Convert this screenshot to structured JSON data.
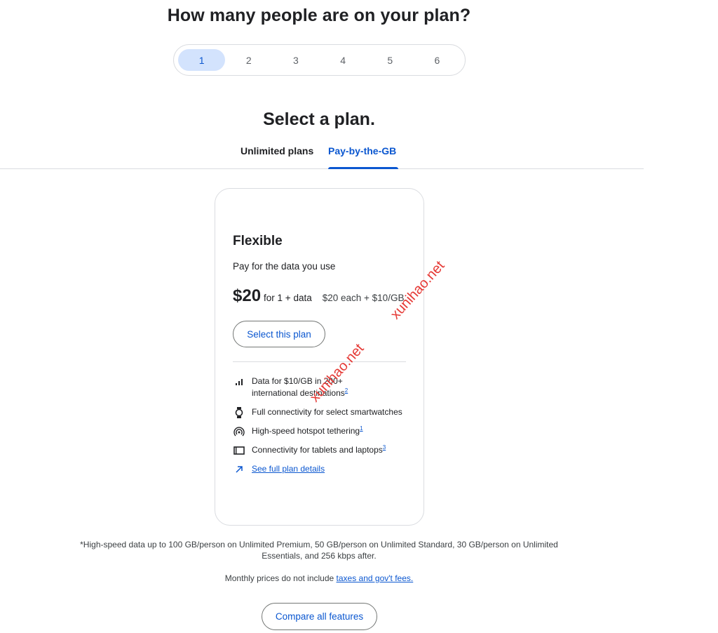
{
  "people_section": {
    "heading": "How many people are on your plan?",
    "options": [
      "1",
      "2",
      "3",
      "4",
      "5",
      "6"
    ],
    "selected": "1"
  },
  "plan_section": {
    "heading": "Select a plan.",
    "tabs": [
      {
        "label": "Unlimited plans",
        "active": false
      },
      {
        "label": "Pay-by-the-GB",
        "active": true
      }
    ]
  },
  "plan_card": {
    "name": "Flexible",
    "description": "Pay for the data you use",
    "price": "$20",
    "price_for": "for 1 + data",
    "price_each": "$20 each + $10/GB",
    "select_button": "Select this plan",
    "features": [
      {
        "icon": "signal-bars-icon",
        "text_line1": "Data for $10/GB in 200+",
        "text_line2": "international destinations",
        "sup": "2"
      },
      {
        "icon": "smartwatch-icon",
        "text": "Full connectivity for select smartwatches",
        "sup": ""
      },
      {
        "icon": "hotspot-icon",
        "text": "High-speed hotspot tethering",
        "sup": "1"
      },
      {
        "icon": "tablet-icon",
        "text": "Connectivity for tablets and laptops",
        "sup": "3"
      },
      {
        "icon": "arrow-up-right-icon",
        "link": "See full plan details"
      }
    ]
  },
  "footer": {
    "footnote_line1": "*High-speed data up to 100 GB/person on Unlimited Premium, 50 GB/person on Unlimited Standard, 30 GB/person on Unlimited",
    "footnote_line2": "Essentials, and 256 kbps after.",
    "monthly_prefix": "Monthly prices do not include ",
    "monthly_link": "taxes and gov't fees.",
    "compare_button": "Compare all features"
  },
  "watermarks": [
    "xunihao.net",
    "xunihao.net"
  ],
  "colors": {
    "accent": "#0b57d0",
    "selected_bg": "#d3e3fd",
    "border": "#dadce0",
    "watermark": "#e53935"
  }
}
